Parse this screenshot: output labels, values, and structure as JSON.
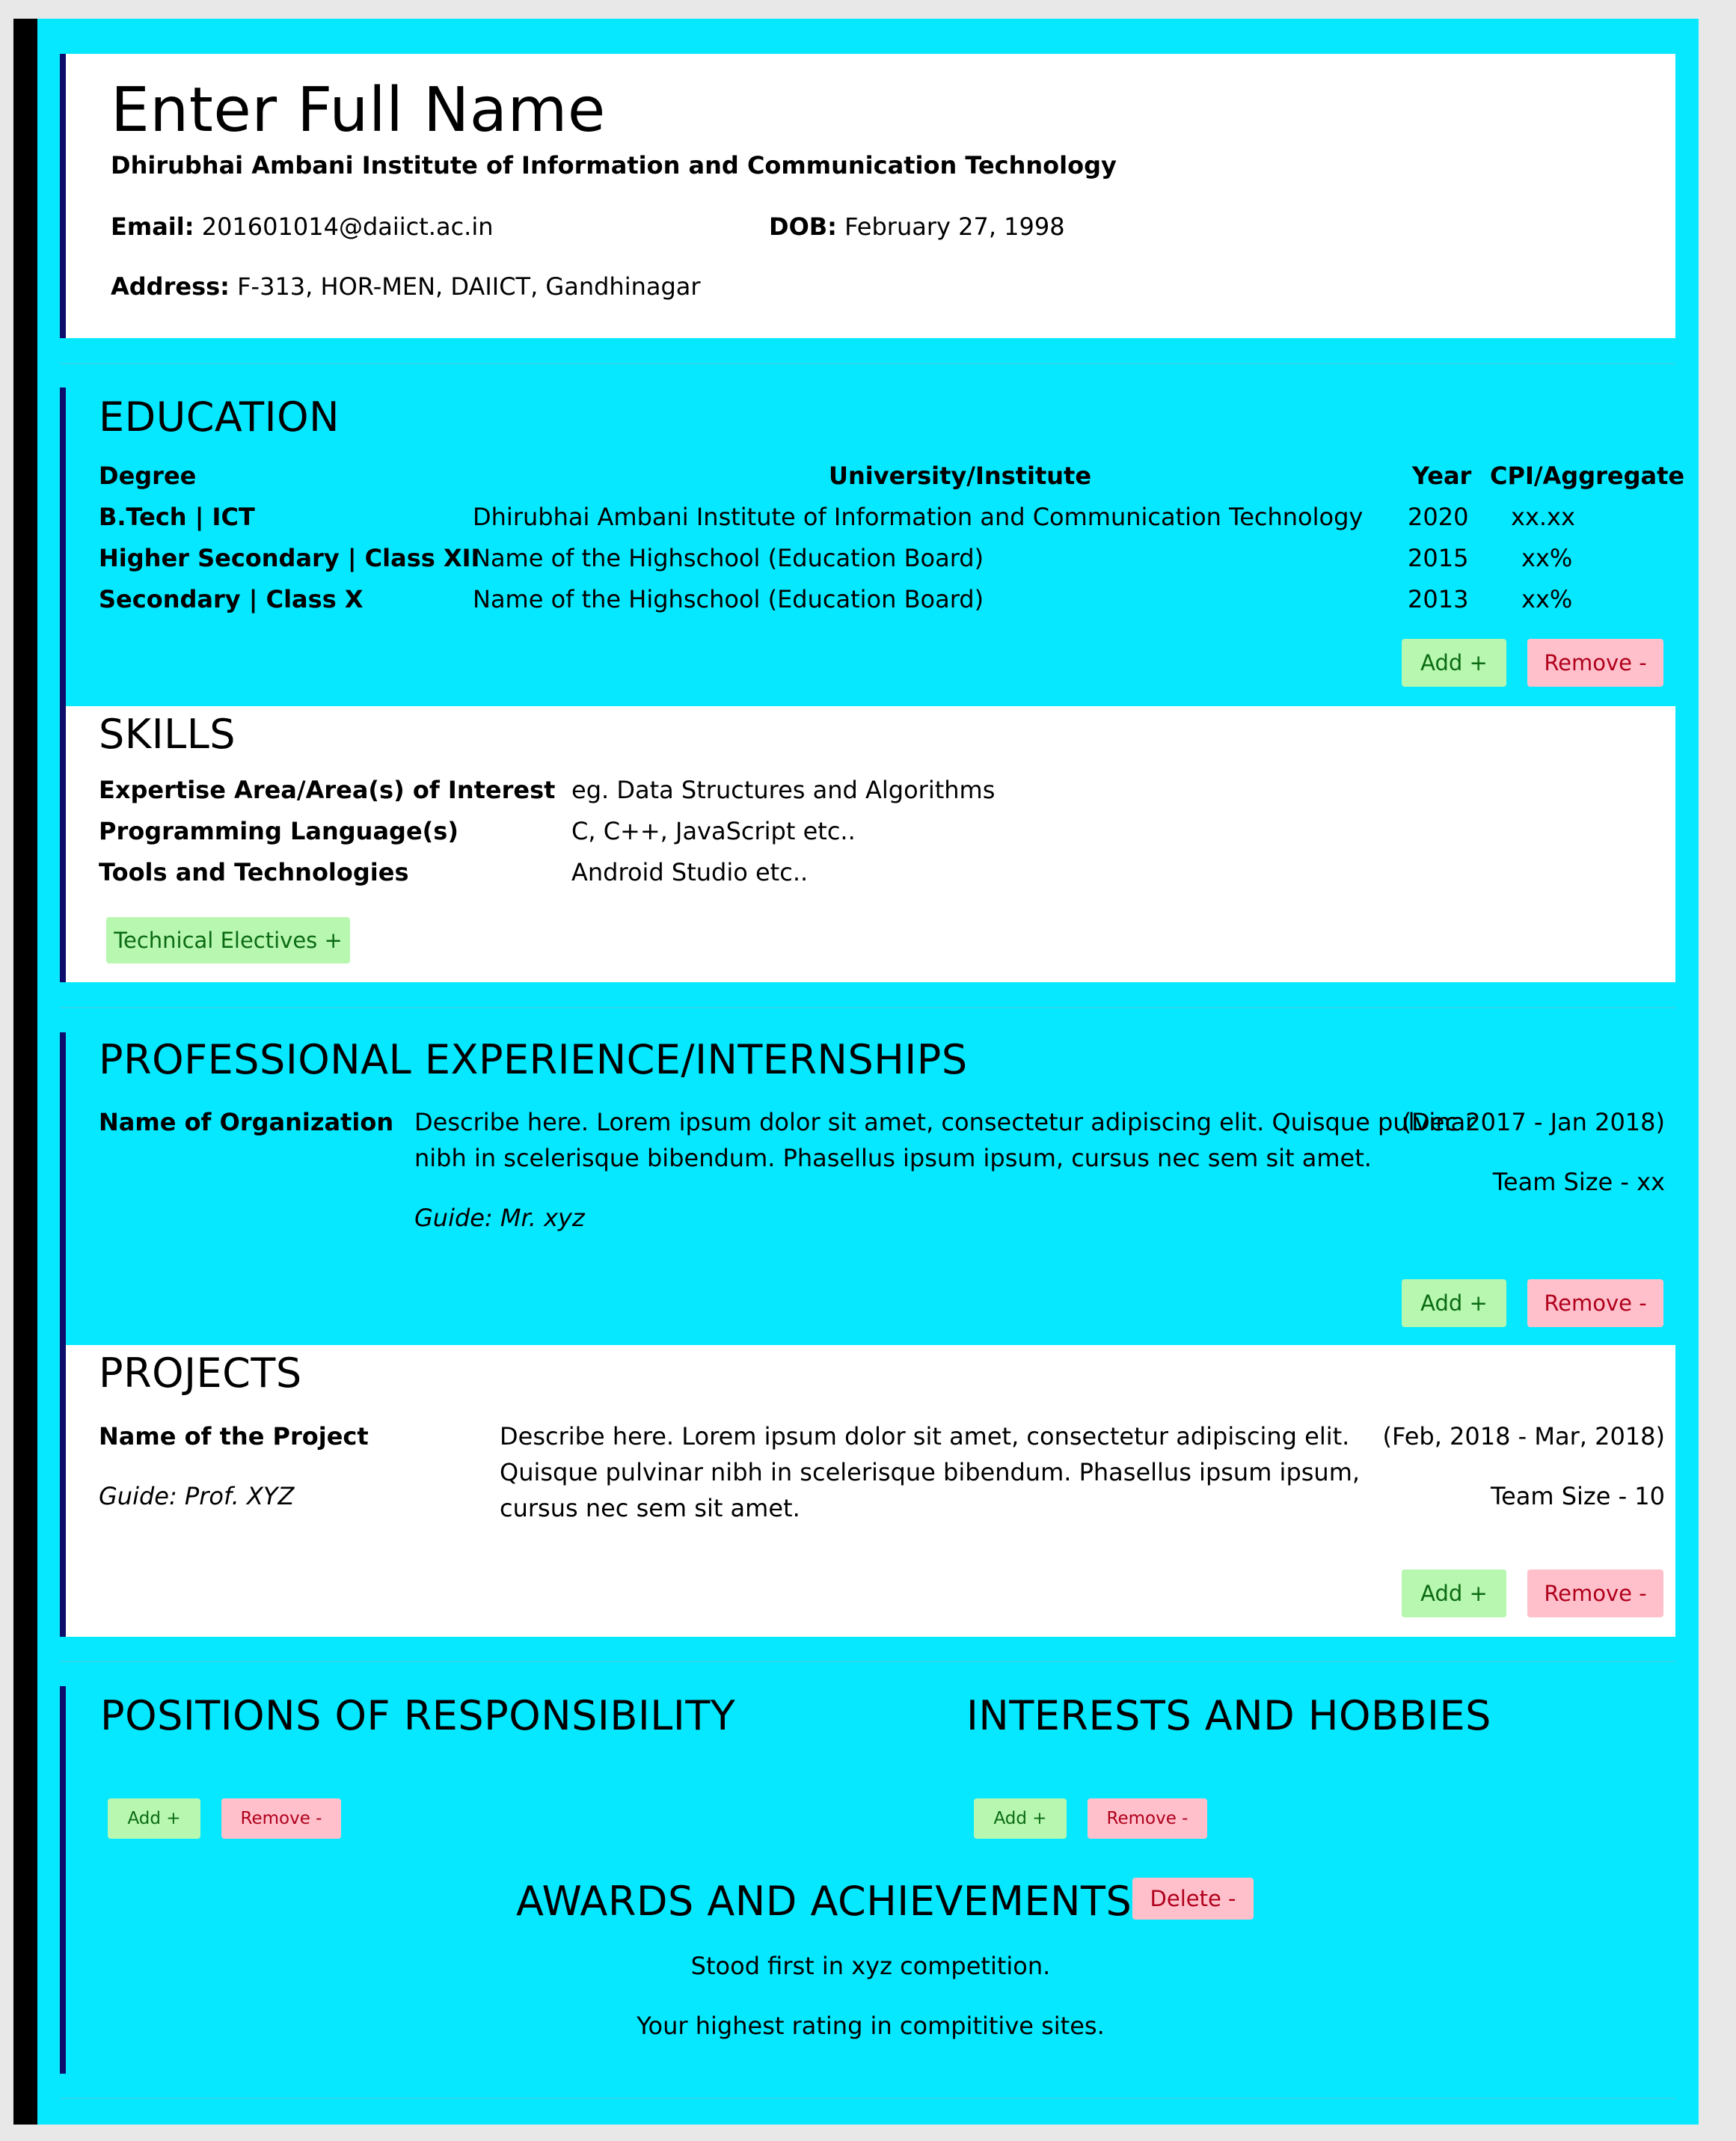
{
  "header": {
    "full_name": "Enter Full Name",
    "institute": "Dhirubhai Ambani Institute of Information and Communication Technology",
    "email_label": "Email:",
    "email_value": "201601014@daiict.ac.in",
    "dob_label": "DOB:",
    "dob_value": "February 27, 1998",
    "address_label": "Address:",
    "address_value": "F-313, HOR-MEN, DAIICT, Gandhinagar"
  },
  "education": {
    "title": "EDUCATION",
    "headers": [
      "Degree",
      "University/Institute",
      "Year",
      "CPI/Aggregate"
    ],
    "rows": [
      [
        "B.Tech | ICT",
        "Dhirubhai Ambani Institute of Information and Communication Technology",
        "2020",
        "xx.xx"
      ],
      [
        "Higher Secondary | Class XII",
        "Name of the Highschool (Education Board)",
        "2015",
        "xx%"
      ],
      [
        "Secondary | Class X",
        "Name of the Highschool (Education Board)",
        "2013",
        "xx%"
      ]
    ],
    "add_label": "Add +",
    "remove_label": "Remove -"
  },
  "skills": {
    "title": "SKILLS",
    "rows": [
      [
        "Expertise Area/Area(s) of Interest",
        "eg. Data Structures and Algorithms"
      ],
      [
        "Programming Language(s)",
        "C, C++, JavaScript etc.."
      ],
      [
        "Tools and Technologies",
        "Android Studio etc.."
      ]
    ],
    "electives_label": "Technical Electives +"
  },
  "experience": {
    "title": "PROFESSIONAL EXPERIENCE/INTERNSHIPS",
    "org": "Name of Organization",
    "desc_line1": "Describe here. Lorem ipsum dolor sit amet, consectetur adipiscing elit. Quisque pulvinar",
    "desc_line2": "nibh in scelerisque bibendum. Phasellus ipsum ipsum, cursus nec sem sit amet.",
    "guide": "Guide: Mr. xyz",
    "dates": "(Dec 2017 - Jan 2018)",
    "team": "Team Size - xx",
    "add_label": "Add +",
    "remove_label": "Remove -"
  },
  "projects": {
    "title": "PROJECTS",
    "name": "Name of the Project",
    "guide": "Guide: Prof. XYZ",
    "desc_line1": "Describe here. Lorem ipsum dolor sit amet, consectetur adipiscing elit.",
    "desc_line2": "Quisque pulvinar nibh in scelerisque bibendum. Phasellus ipsum ipsum,",
    "desc_line3": "cursus nec sem sit amet.",
    "dates": "(Feb, 2018 - Mar, 2018)",
    "team": "Team Size - 10",
    "add_label": "Add +",
    "remove_label": "Remove -"
  },
  "positions": {
    "title": "POSITIONS OF RESPONSIBILITY",
    "add_label": "Add +",
    "remove_label": "Remove -"
  },
  "interests": {
    "title": "INTERESTS AND HOBBIES",
    "add_label": "Add +",
    "remove_label": "Remove -"
  },
  "awards": {
    "title": "AWARDS AND ACHIEVEMENTS",
    "delete_label": "Delete -",
    "items": [
      "Stood first in xyz competition.",
      "Your highest rating in compititive sites."
    ]
  }
}
